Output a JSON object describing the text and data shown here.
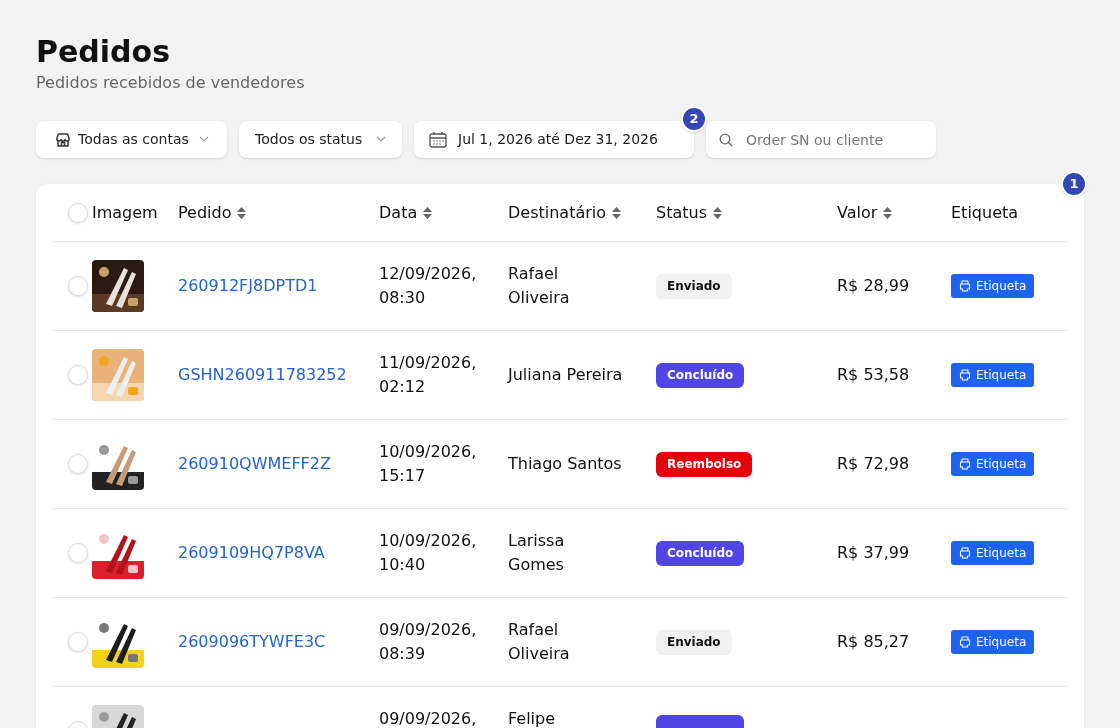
{
  "header": {
    "title": "Pedidos",
    "subtitle": "Pedidos recebidos de vendedores"
  },
  "filters": [
    {
      "kind": "account",
      "label": "Todas as contas"
    },
    {
      "kind": "status",
      "label": "Todos os status"
    },
    {
      "kind": "date",
      "label": "Jul 1, 2026 até Dez 31, 2026",
      "marker": "2"
    }
  ],
  "search": {
    "placeholder": "Order SN ou cliente"
  },
  "table": {
    "marker": "1",
    "select_all_checked": false,
    "columns": [
      {
        "label": "Imagem",
        "sortable": false
      },
      {
        "label": "Pedido",
        "sortable": true
      },
      {
        "label": "Data",
        "sortable": true
      },
      {
        "label": "Destinatário",
        "sortable": true
      },
      {
        "label": "Status",
        "sortable": true
      },
      {
        "label": "Valor",
        "sortable": true
      },
      {
        "label": "Etiqueta",
        "sortable": false
      }
    ],
    "rows": [
      {
        "checked": false,
        "image": {
          "kind": "picture"
        },
        "order": "260912FJ8DPTD1",
        "date": [
          "12/09/2026,",
          "08:30"
        ],
        "recipient": [
          "Rafael",
          "Oliveira"
        ],
        "status": {
          "kind": "enviado",
          "label": "Enviado"
        },
        "value": "R$ 28,99",
        "action": "Etiqueta"
      },
      {
        "checked": false,
        "image": {
          "kind": "picture"
        },
        "order": "GSHN260911783252",
        "date": [
          "11/09/2026,",
          "02:12"
        ],
        "recipient": [
          "Juliana Pereira"
        ],
        "status": {
          "kind": "concluido",
          "label": "Concluído"
        },
        "value": "R$ 53,58",
        "action": "Etiqueta"
      },
      {
        "checked": false,
        "image": {
          "kind": "picture"
        },
        "order": "260910QWMEFF2Z",
        "date": [
          "10/09/2026,",
          "15:17"
        ],
        "recipient": [
          "Thiago Santos"
        ],
        "status": {
          "kind": "reembolso",
          "label": "Reembolso"
        },
        "value": "R$ 72,98",
        "action": "Etiqueta"
      },
      {
        "checked": false,
        "image": {
          "kind": "picture"
        },
        "order": "2609109HQ7P8VA",
        "date": [
          "10/09/2026,",
          "10:40"
        ],
        "recipient": [
          "Larissa",
          "Gomes"
        ],
        "status": {
          "kind": "concluido",
          "label": "Concluído"
        },
        "value": "R$ 37,99",
        "action": "Etiqueta"
      },
      {
        "checked": false,
        "image": {
          "kind": "picture"
        },
        "order": "2609096TYWFE3C",
        "date": [
          "09/09/2026,",
          "08:39"
        ],
        "recipient": [
          "Rafael",
          "Oliveira"
        ],
        "status": {
          "kind": "enviado",
          "label": "Enviado"
        },
        "value": "R$ 85,27",
        "action": "Etiqueta"
      },
      {
        "checked": false,
        "image": {
          "kind": "picture"
        },
        "date": [
          "09/09/2026,"
        ],
        "recipient": [
          "Felipe"
        ],
        "status": {
          "kind": "concluido"
        }
      }
    ]
  }
}
